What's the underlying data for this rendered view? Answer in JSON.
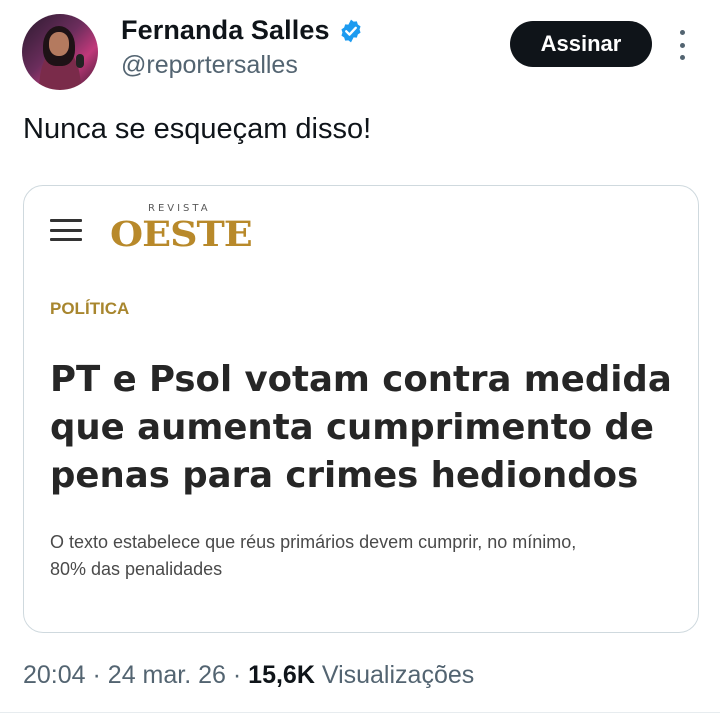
{
  "author": {
    "name": "Fernanda Salles",
    "handle": "@reportersalles",
    "verified_icon": "verified-badge-icon",
    "verified_color": "#1d9bf0"
  },
  "actions": {
    "follow_label": "Assinar",
    "more_icon": "more-vertical-icon"
  },
  "tweet": {
    "text": "Nunca se esqueçam disso!"
  },
  "card": {
    "menu_icon": "hamburger-menu-icon",
    "logo_top": "REVISTA",
    "logo_main": "OESTE",
    "logo_color": "#b8892a",
    "category": "POLÍTICA",
    "headline_lines": [
      "PT e Psol votam contra medida",
      "que aumenta cumprimento de",
      "penas para crimes hediondos"
    ],
    "summary_lines": [
      "O texto estabelece que réus primários devem cumprir, no mínimo,",
      "80% das penalidades"
    ]
  },
  "meta": {
    "time": "20:04",
    "separator": "·",
    "date": "24 mar. 26",
    "views_count": "15,6K",
    "views_label": "Visualizações"
  }
}
